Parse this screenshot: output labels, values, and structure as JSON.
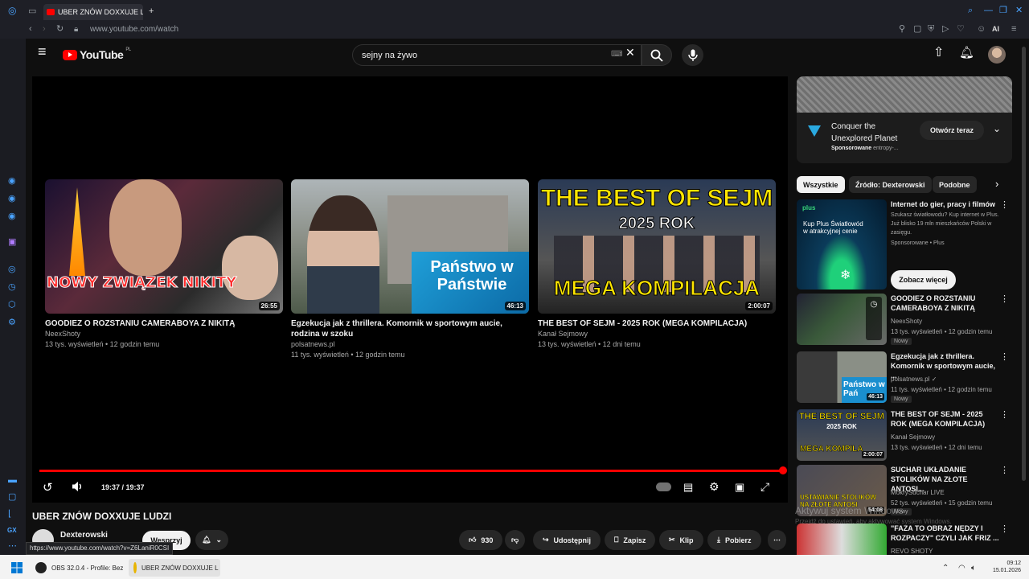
{
  "browser": {
    "tab_title": "UBER ZNÓW DOXXUJE LU",
    "url": "www.youtube.com/watch",
    "status_url": "https://www.youtube.com/watch?v=Z6LaniR0CSI",
    "ai_label": "AI"
  },
  "header": {
    "logo": "YouTube",
    "region": "PL",
    "search_value": "sejny na żywo"
  },
  "player": {
    "time": "19:37 / 19:37",
    "progress": 1.0,
    "end_cards": [
      {
        "title": "GOODIEZ O ROZSTANIU CAMERABOYA Z NIKITĄ",
        "channel": "NeexShoty",
        "meta": "13 tys. wyświetleń • 12 godzin temu",
        "duration": "26:55",
        "overlay": "NOWY ZWIĄZEK NIKITY"
      },
      {
        "title": "Egzekucja jak z thrillera. Komornik w sportowym aucie, rodzina w szoku",
        "channel": "polsatnews.pl",
        "meta": "11 tys. wyświetleń • 12 godzin temu",
        "duration": "46:13",
        "overlay": "Państwo w Państwie"
      },
      {
        "title": "THE BEST OF SEJM - 2025 ROK (MEGA KOMPILACJA)",
        "channel": "Kanał Sejmowy",
        "meta": "13 tys. wyświetleń • 12 dni temu",
        "duration": "2:00:07",
        "overlay_top": "THE BEST OF SEJM",
        "overlay_year": "2025 ROK",
        "overlay_bottom": "MEGA KOMPILACJA"
      }
    ]
  },
  "video": {
    "title": "UBER ZNÓW DOXXUJE LUDZI",
    "channel": "Dexterowski",
    "subscribe": "Wesprzyj",
    "likes": "930",
    "share": "Udostępnij",
    "save": "Zapisz",
    "clip": "Klip",
    "download": "Pobierz"
  },
  "ad": {
    "title": "Conquer the Unexplored Planet",
    "sponsor": "Sponsorowane",
    "advertiser": "entropy-...",
    "cta": "Otwórz teraz"
  },
  "chips": [
    "Wszystkie",
    "Źródło: Dexterowski",
    "Podobne"
  ],
  "recommendations": [
    {
      "title": "Internet do gier, pracy i filmów",
      "desc": "Szukasz światłowodu? Kup internet w Plus. Już blisko 19 mln mieszkańców Polski w zasięgu.",
      "meta": "Sponsorowane • Plus",
      "button": "Zobacz więcej",
      "thumb_text": "Kup Plus Światłowód w atrakcyjnej cenie",
      "thumb_brand": "plus"
    },
    {
      "title": "GOODIEZ O ROZSTANIU CAMERABOYA Z NIKITĄ",
      "channel": "NeexShoty",
      "meta": "13 tys. wyświetleń • 12 godzin temu",
      "badge": "Nowy"
    },
    {
      "title": "Egzekucja jak z thrillera. Komornik w sportowym aucie, ...",
      "channel": "polsatnews.pl",
      "meta": "11 tys. wyświetleń • 12 godzin temu",
      "badge": "Nowy",
      "duration": "46:13",
      "thumb_text": "Państwo w Pań"
    },
    {
      "title": "THE BEST OF SEJM - 2025 ROK (MEGA KOMPILACJA)",
      "channel": "Kanał Sejmowy",
      "meta": "13 tys. wyświetleń • 12 dni temu",
      "duration": "2:00:07",
      "thumb_top": "THE BEST OF SEJM",
      "thumb_year": "2025 ROK",
      "thumb_bottom": "MEGA KOMPILA"
    },
    {
      "title": "SUCHAR UKŁADANIE STOLIKÓW NA ZŁOTE ANTOSI...",
      "channel": "MokrySuchar LIVE",
      "meta": "52 tys. wyświetleń • 15 godzin temu",
      "badge": "Nowy",
      "duration": "54:08",
      "thumb_text": "USTAWIANIE STOLIKÓW NA ZŁOTE ANTOSI"
    },
    {
      "title": "\"FAZA TO OBRAZ NĘDZY I ROZPACZY\" CZYLI JAK FRIZ ...",
      "channel": "REVO SHOTY"
    }
  ],
  "watermark": {
    "line1": "Aktywuj system Windows",
    "line2": "Przejdź do ustawień, aby aktywować system Windows."
  },
  "taskbar": {
    "obs": "OBS 32.0.4 - Profile: Bez",
    "browser": "UBER ZNÓW DOXXUJE L",
    "time": "09:12",
    "date": "15.01.2026"
  },
  "colors": {
    "accent": "#ff0000",
    "background": "#0f0f0f",
    "chip_active": "#f1f1f1"
  }
}
